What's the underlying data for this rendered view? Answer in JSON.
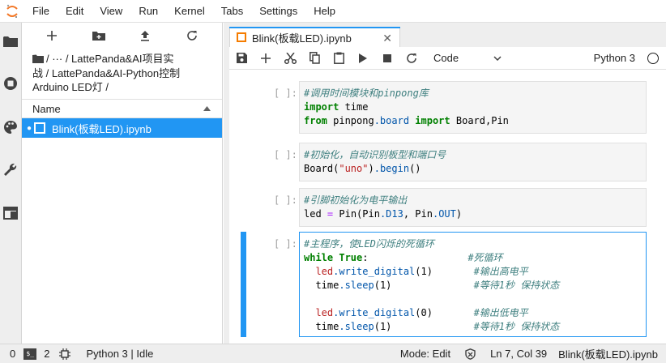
{
  "menubar": {
    "items": [
      "File",
      "Edit",
      "View",
      "Run",
      "Kernel",
      "Tabs",
      "Settings",
      "Help"
    ]
  },
  "filebrowser": {
    "breadcrumb_line1": "/ ··· / LattePanda&AI项目实",
    "breadcrumb_line2": "战 / LattePanda&AI-Python控制",
    "breadcrumb_line3": "Arduino LED灯 /",
    "column_name": "Name",
    "files": [
      {
        "name": "Blink(板载LED).ipynb",
        "running": true
      }
    ]
  },
  "tab": {
    "title": "Blink(板载LED).ipynb"
  },
  "toolbar": {
    "cell_type": "Code",
    "kernel_name": "Python 3"
  },
  "cells": [
    {
      "prompt": "[ ]:",
      "active": false
    },
    {
      "prompt": "[ ]:",
      "active": false
    },
    {
      "prompt": "[ ]:",
      "active": false
    },
    {
      "prompt": "[ ]:",
      "active": true
    }
  ],
  "code": {
    "c1_l1": "#调用时间模块和pinpong库",
    "c1_kw_import": "import",
    "c1_time": " time",
    "c1_kw_from": "from",
    "c1_pinpong": " pinpong",
    "c1_dot_board": ".board",
    "c1_kw_import2": " import",
    "c1_rest": " Board,Pin",
    "c2_comment": "#初始化，自动识别板型和端口号",
    "c2_board": "Board(",
    "c2_str": "\"uno\"",
    "c2_close": ")",
    "c2_begin": ".begin",
    "c2_end": "()",
    "c3_comment": "#引脚初始化为电平输出",
    "c3_led": "led ",
    "c3_eq": "=",
    "c3_pin": " Pin(Pin",
    "c3_d13": ".D13",
    "c3_mid": ", Pin",
    "c3_out": ".OUT",
    "c3_end": ")",
    "c4_comment": "#主程序，使LED闪烁的死循环",
    "c4_while": "while",
    "c4_true": " True",
    "c4_colon": ":",
    "c4_c_loop": "#死循环",
    "c4_led1": "led",
    "c4_wd1": ".write_digital",
    "c4_arg1": "(1)",
    "c4_c_high": "#输出高电平",
    "c4_time1": "time",
    "c4_sleep1": ".sleep",
    "c4_sarg1": "(1)",
    "c4_c_wait1": "#等待1秒 保持状态",
    "c4_led2": "led",
    "c4_wd2": ".write_digital",
    "c4_arg2": "(0)",
    "c4_c_low": "#输出低电平",
    "c4_time2": "time",
    "c4_sleep2": ".sleep",
    "c4_sarg2": "(1)",
    "c4_c_wait2": "#等待1秒 保持状态"
  },
  "statusbar": {
    "kernels": "0",
    "terminals": "2",
    "kernel_status": "Python 3 | Idle",
    "mode": "Mode: Edit",
    "cursor": "Ln 7, Col 39",
    "filename": "Blink(板载LED).ipynb"
  },
  "colors": {
    "accent": "#2196f3",
    "notebook_icon": "#f57c00",
    "jupyter_orange": "#f37726"
  }
}
